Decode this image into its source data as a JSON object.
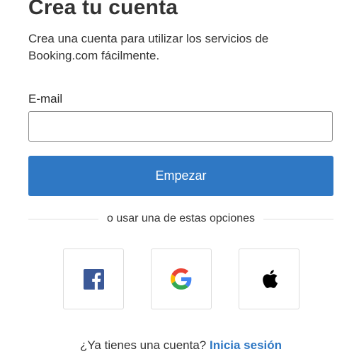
{
  "header": {
    "title": "Crea tu cuenta",
    "subtitle": "Crea una cuenta para utilizar los servicios de Booking.com fácilmente."
  },
  "form": {
    "email_label": "E-mail",
    "email_value": "",
    "email_placeholder": "",
    "submit_label": "Empezar"
  },
  "divider": {
    "text": "o usar una de estas opciones"
  },
  "social": [
    {
      "provider": "facebook",
      "icon": "facebook-icon",
      "color": "#3b5998"
    },
    {
      "provider": "google",
      "icon": "google-icon",
      "color": "#4285f4"
    },
    {
      "provider": "apple",
      "icon": "apple-icon",
      "color": "#000000"
    }
  ],
  "footer": {
    "prompt": "¿Ya tienes una cuenta?",
    "link_label": "Inicia sesión"
  },
  "colors": {
    "primary": "#2f78c4",
    "text": "#333333",
    "border": "#dcdcdc"
  }
}
